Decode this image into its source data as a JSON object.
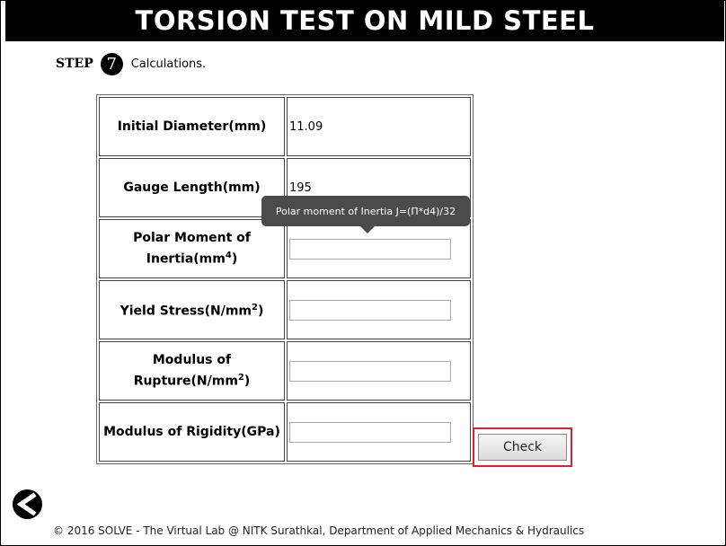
{
  "header": {
    "title": "TORSION TEST ON MILD STEEL"
  },
  "step": {
    "label": "STEP",
    "number": "7",
    "description": "Calculations."
  },
  "rows": [
    {
      "label": "Initial Diameter(mm)",
      "value": "11.09"
    },
    {
      "label": "Gauge Length(mm)",
      "value": "195"
    },
    {
      "label_main": "Polar Moment of Inertia(mm",
      "label_sup": "4",
      "label_end": ")",
      "input_value": ""
    },
    {
      "label_main": "Yield Stress(N/mm",
      "label_sup": "2",
      "label_end": ")",
      "input_value": ""
    },
    {
      "label_main": "Modulus of Rupture(N/mm",
      "label_sup": "2",
      "label_end": ")",
      "input_value": ""
    },
    {
      "label": "Modulus of Rigidity(GPa)",
      "input_value": ""
    }
  ],
  "tooltip": {
    "text": "Polar moment of Inertia J=(Π*d4)/32"
  },
  "actions": {
    "check_label": "Check",
    "back_icon": "back-arrow-icon"
  },
  "footer": {
    "text": "© 2016 SOLVE - The Virtual Lab @ NITK Surathkal, Department of Applied Mechanics & Hydraulics"
  },
  "colors": {
    "title_bg": "#000000",
    "title_fg": "#ffffff",
    "highlight": "#e0202e",
    "tooltip_bg": "#4b4b4b"
  }
}
